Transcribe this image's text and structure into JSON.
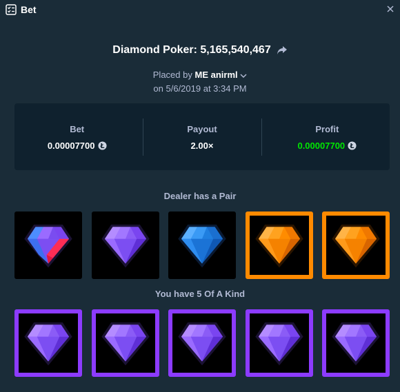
{
  "window": {
    "title": "Bet",
    "icon": "checklist-icon",
    "close_icon": "close-icon"
  },
  "header": {
    "game": "Diamond Poker:",
    "bet_id": "5,165,540,467",
    "share_icon": "share-icon"
  },
  "placed": {
    "prefix": "Placed by",
    "username": "ME anirml",
    "date": "on 5/6/2019 at 3:34 PM"
  },
  "stats": {
    "bet_label": "Bet",
    "bet_value": "0.00007700",
    "payout_label": "Payout",
    "payout_value": "2.00×",
    "profit_label": "Profit",
    "profit_value": "0.00007700",
    "currency_icon": "litecoin-icon",
    "profit_color": "#00e701"
  },
  "dealer": {
    "caption": "Dealer has a Pair",
    "gems": [
      "multicolor",
      "purple",
      "blue",
      "orange",
      "orange"
    ],
    "highlighted": [
      false,
      false,
      false,
      true,
      true
    ]
  },
  "player": {
    "caption": "You have 5 Of A Kind",
    "gems": [
      "purple",
      "purple",
      "purple",
      "purple",
      "purple"
    ],
    "highlighted": [
      true,
      true,
      true,
      true,
      true
    ]
  },
  "colors": {
    "background": "#1a2c38",
    "panel": "#0f212e",
    "highlight_orange": "#ff8a00",
    "highlight_purple": "#8c3bff"
  }
}
